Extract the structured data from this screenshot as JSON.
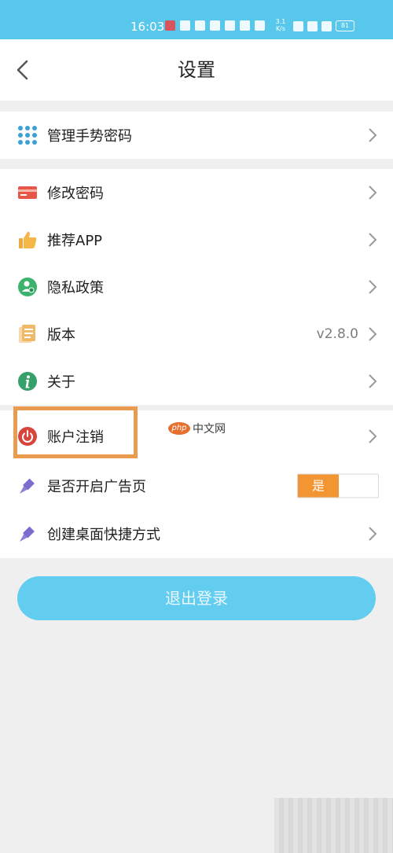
{
  "status_bar": {
    "time": "16:03",
    "speed_top": "3.1",
    "speed_unit": "K/s",
    "battery": "81"
  },
  "header": {
    "title": "设置"
  },
  "groups": [
    {
      "items": [
        {
          "label": "管理手势密码",
          "icon": "grid-dots-icon"
        }
      ]
    },
    {
      "items": [
        {
          "label": "修改密码",
          "icon": "card-icon"
        },
        {
          "label": "推荐APP",
          "icon": "thumbs-up-icon"
        },
        {
          "label": "隐私政策",
          "icon": "privacy-user-icon"
        },
        {
          "label": "版本",
          "value": "v2.8.0",
          "icon": "document-icon"
        },
        {
          "label": "关于",
          "icon": "info-icon"
        }
      ]
    },
    {
      "items": [
        {
          "label": "账户注销",
          "icon": "power-icon"
        },
        {
          "label": "是否开启广告页",
          "icon": "pen-icon",
          "toggle": {
            "on_label": "是",
            "state": true
          }
        },
        {
          "label": "创建桌面快捷方式",
          "icon": "pen-icon"
        }
      ]
    }
  ],
  "logout_label": "退出登录",
  "watermark": {
    "brand": "php",
    "site": "中文网"
  },
  "colors": {
    "primary": "#57c7ec",
    "button": "#63cdf0",
    "toggle_on": "#f39532",
    "highlight": "#e99b50"
  }
}
